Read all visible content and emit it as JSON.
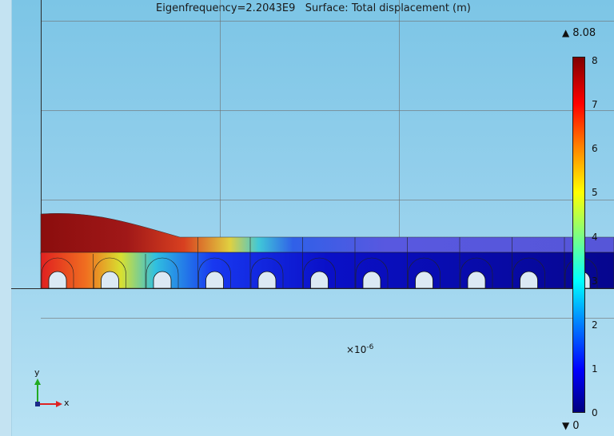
{
  "plot": {
    "title": "Eigenfrequency=2.2043E9   Surface: Total displacement (m)",
    "exponent_base": "×10",
    "exponent_power": "-6"
  },
  "triad": {
    "y_label": "y",
    "x_label": "x"
  },
  "colorbar": {
    "max_label": "8.08",
    "min_label": "0",
    "ticks": [
      "8",
      "7",
      "6",
      "5",
      "4",
      "3",
      "2",
      "1",
      "0"
    ],
    "colors": [
      "#00007f",
      "#0000ff",
      "#00ffff",
      "#ffff00",
      "#ff0000",
      "#7f0000"
    ]
  }
}
